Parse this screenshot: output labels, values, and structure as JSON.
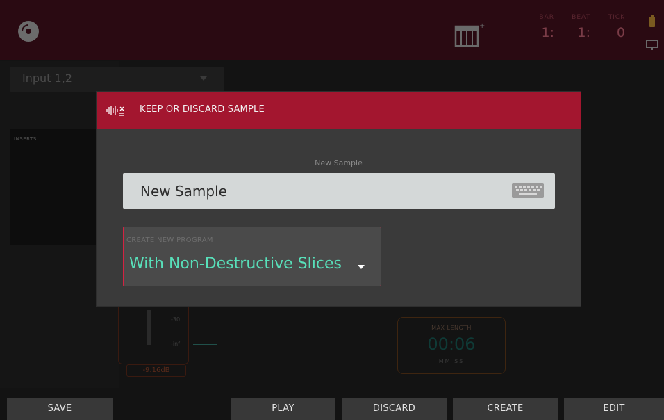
{
  "background": {
    "counters": [
      {
        "label": "BAR",
        "value": "1:"
      },
      {
        "label": "BEAT",
        "value": "1:"
      },
      {
        "label": "TICK",
        "value": "0"
      }
    ],
    "input_select": "Input 1,2",
    "inserts_label": "INSERTS",
    "fader_ticks": [
      "-30",
      "-inf"
    ],
    "db_readout": "-9.16dB",
    "max_length_label": "MAX LENGTH",
    "max_length_value": "00:06",
    "max_length_units": "MM   SS"
  },
  "modal": {
    "title": "KEEP OR DISCARD SAMPLE",
    "name_label": "New Sample",
    "name_value": "New Sample",
    "program_label": "CREATE NEW PROGRAM",
    "program_value": "With Non-Destructive Slices"
  },
  "bottom_buttons": {
    "save": "SAVE",
    "play": "PLAY",
    "discard": "DISCARD",
    "create": "CREATE",
    "edit": "EDIT"
  },
  "colors": {
    "header_red": "#a3162f",
    "accent_teal": "#58e0ba",
    "select_border": "#d32342"
  }
}
